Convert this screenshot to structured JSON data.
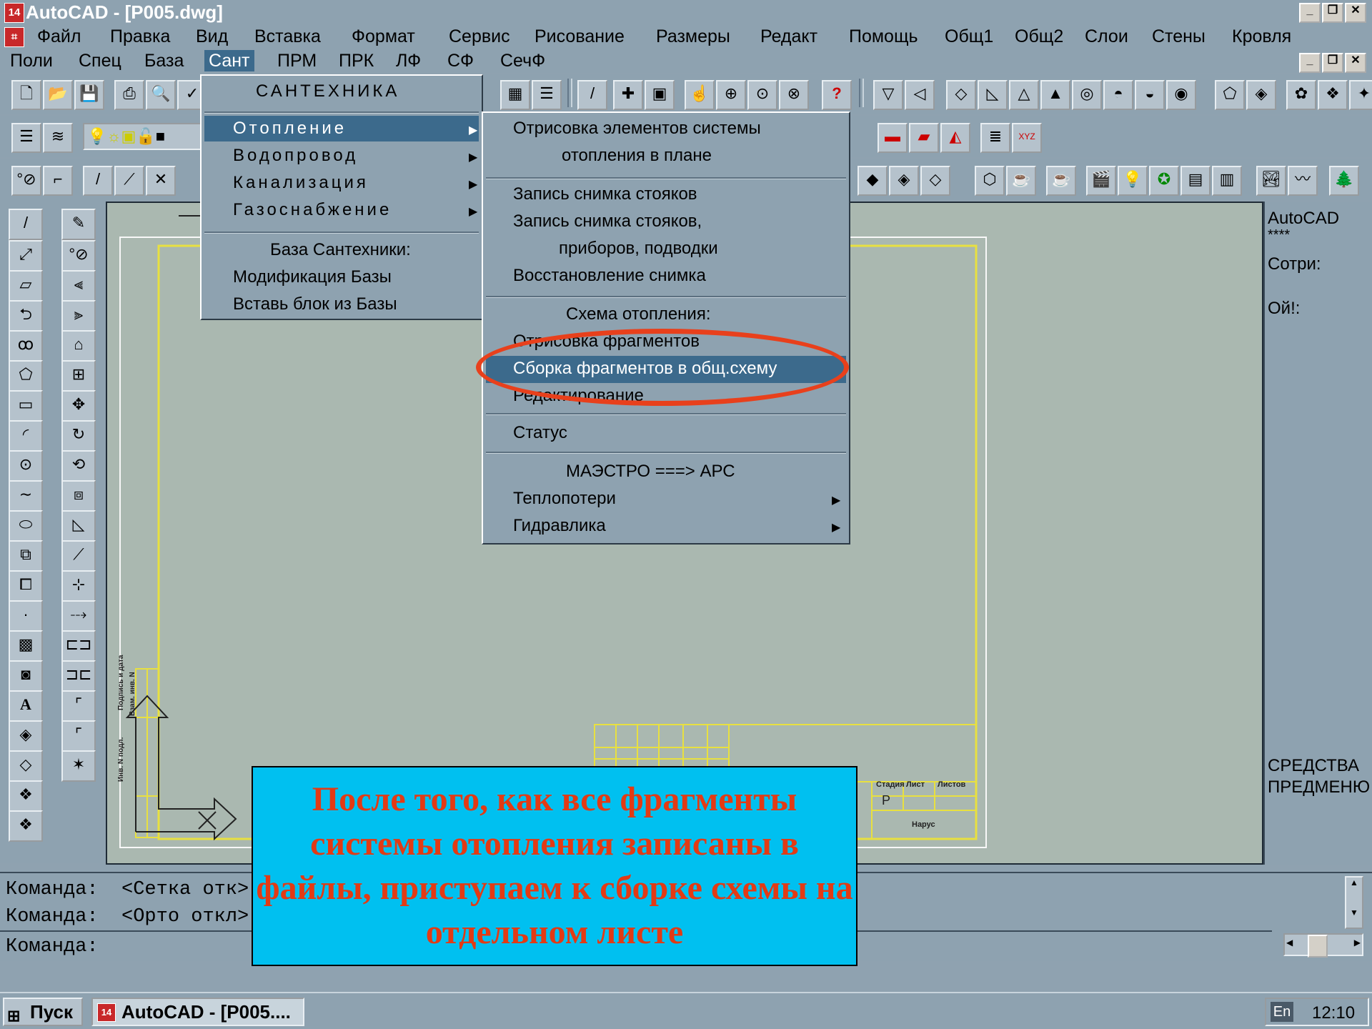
{
  "window": {
    "title": "AutoCAD - [P005.dwg]",
    "app_icon": "14"
  },
  "menubar1": [
    "Файл",
    "Правка",
    "Вид",
    "Вставка",
    "Формат",
    "Сервис",
    "Рисование",
    "Размеры",
    "Редакт",
    "Помощь",
    "Общ1",
    "Общ2",
    "Слои",
    "Стены",
    "Кровля"
  ],
  "menubar2": [
    "Поли",
    "Спец",
    "База",
    "Сант",
    "ПРМ",
    "ПРК",
    "ЛФ",
    "СФ",
    "СечФ"
  ],
  "sant_menu": {
    "header": "САНТЕХНИКА",
    "items": [
      "Отопление",
      "Водопровод",
      "Канализация",
      "Газоснабжение"
    ],
    "db_title": "База Сантехники:",
    "db_items": [
      "Модификация Базы",
      "Вставь блок из Базы"
    ]
  },
  "heating_menu": {
    "group1": [
      "Отрисовка элементов системы",
      "отопления в плане"
    ],
    "group2": [
      "Запись снимка стояков",
      "Запись снимка стояков,",
      "приборов, подводки",
      "Восстановление снимка"
    ],
    "scheme_title": "Схема отопления:",
    "scheme_items": [
      "Отрисовка фрагментов",
      "Сборка фрагментов в общ.схему",
      "Редактирование"
    ],
    "status": "Статус",
    "maestro": "МАЭСТРО ===> АРС",
    "submenus": [
      "Теплопотери",
      "Гидравлика"
    ]
  },
  "side_menu": [
    "AutoCAD",
    "****",
    "Сотри:",
    "Ой!:",
    "СРЕДСТВА",
    "ПРЕДМЕНЮ"
  ],
  "title_block": {
    "col_labels": [
      "Стадия",
      "Лист",
      "Листов"
    ],
    "stage": "P",
    "extra": "Нарус"
  },
  "margin_labels": [
    "Взам. инв. N",
    "Подпись и дата",
    "Инв. N подл."
  ],
  "command": {
    "line1": "Команда:  <Сетка отк>",
    "line2": "Команда:  <Орто откл>",
    "line3": "Команда:"
  },
  "callout": "После того, как все фрагменты системы отопления записаны в файлы, приступаем к сборке схемы на отдельном листе",
  "taskbar": {
    "start": "Пуск",
    "task": "AutoCAD - [P005....",
    "lang": "En",
    "time": "12:10"
  },
  "colors": {
    "background": "#8ea2b0",
    "drawing": "#aab8b0",
    "highlight": "#3c6a8c",
    "callout_bg": "#00c0f0",
    "callout_text": "#e33a14",
    "ellipse": "#e8401c",
    "frame": "#e8e040"
  }
}
